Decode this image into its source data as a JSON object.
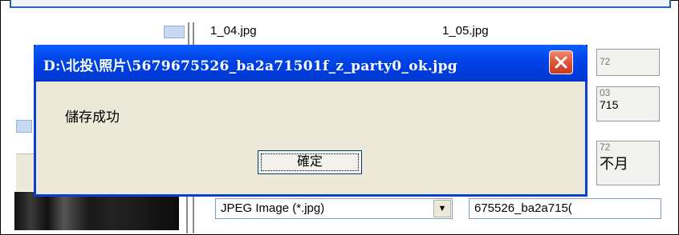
{
  "background": {
    "file1": "1_04.jpg",
    "file2": "1_05.jpg",
    "thumb1": "72",
    "thumb2_line1": "03",
    "thumb2_line2": "715",
    "thumb3_line1": "72",
    "thumb3_line2": "不月",
    "save_type": "JPEG Image (*.jpg)",
    "file_name": "675526_ba2a715("
  },
  "dialog": {
    "title": "D:\\北投\\照片\\5679675526_ba2a71501f_z_party0_ok.jpg",
    "message": "儲存成功",
    "ok_label": "確定"
  },
  "colors": {
    "titlebar": "#0044e8",
    "close": "#e0533a",
    "dialog_bg": "#ece9d8"
  },
  "icons": {
    "close": "close-x-icon",
    "dropdown": "chevron-down-icon"
  }
}
